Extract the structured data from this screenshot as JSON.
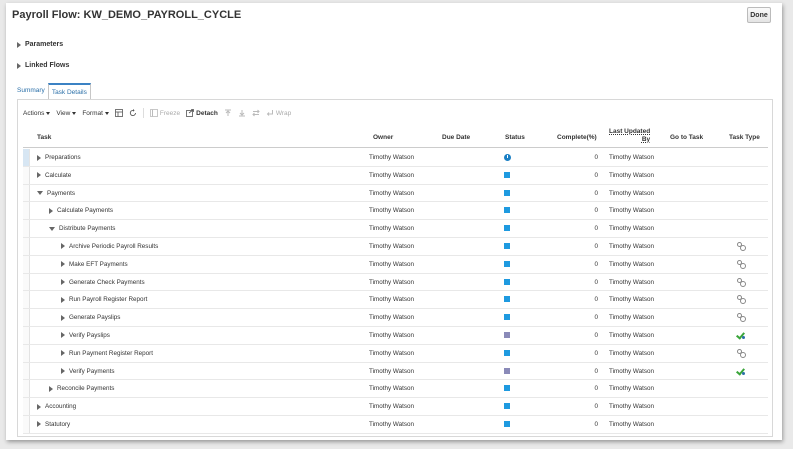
{
  "header": {
    "title": "Payroll Flow: KW_DEMO_PAYROLL_CYCLE",
    "done_label": "Done"
  },
  "sections": {
    "parameters": "Parameters",
    "linked_flows": "Linked Flows"
  },
  "tabs": [
    {
      "label": "Summary"
    },
    {
      "label": "Task Details"
    }
  ],
  "toolbar": {
    "actions": "Actions",
    "view": "View",
    "format": "Format",
    "freeze": "Freeze",
    "detach": "Detach",
    "wrap": "Wrap"
  },
  "columns": {
    "task": "Task",
    "owner": "Owner",
    "due_date": "Due Date",
    "status": "Status",
    "complete": "Complete(%)",
    "last_updated_1": "Last Updated",
    "last_updated_2": "By",
    "go_to_task": "Go to Task",
    "task_type": "Task Type"
  },
  "colors": {
    "status_blue": "#1e9ae0",
    "status_grey": "#8a8ab8",
    "accent": "#2a6fa8"
  },
  "rows": [
    {
      "task": "Preparations",
      "level": 0,
      "expand": "collapsed",
      "owner": "Timothy Watson",
      "status": "clock-icon",
      "complete": "0",
      "updated_by": "Timothy Watson",
      "task_type": ""
    },
    {
      "task": "Calculate",
      "level": 0,
      "expand": "collapsed",
      "owner": "Timothy Watson",
      "status": "blue-square",
      "complete": "0",
      "updated_by": "Timothy Watson",
      "task_type": ""
    },
    {
      "task": "Payments",
      "level": 0,
      "expand": "expanded",
      "owner": "Timothy Watson",
      "status": "blue-square",
      "complete": "0",
      "updated_by": "Timothy Watson",
      "task_type": ""
    },
    {
      "task": "Calculate Payments",
      "level": 1,
      "expand": "collapsed",
      "owner": "Timothy Watson",
      "status": "blue-square",
      "complete": "0",
      "updated_by": "Timothy Watson",
      "task_type": ""
    },
    {
      "task": "Distribute Payments",
      "level": 1,
      "expand": "expanded",
      "owner": "Timothy Watson",
      "status": "blue-square",
      "complete": "0",
      "updated_by": "Timothy Watson",
      "task_type": ""
    },
    {
      "task": "Archive Periodic Payroll Results",
      "level": 2,
      "expand": "collapsed",
      "owner": "Timothy Watson",
      "status": "blue-square",
      "complete": "0",
      "updated_by": "Timothy Watson",
      "task_type": "gear-icon"
    },
    {
      "task": "Make EFT Payments",
      "level": 2,
      "expand": "collapsed",
      "owner": "Timothy Watson",
      "status": "blue-square",
      "complete": "0",
      "updated_by": "Timothy Watson",
      "task_type": "gear-icon"
    },
    {
      "task": "Generate Check Payments",
      "level": 2,
      "expand": "collapsed",
      "owner": "Timothy Watson",
      "status": "blue-square",
      "complete": "0",
      "updated_by": "Timothy Watson",
      "task_type": "gear-icon"
    },
    {
      "task": "Run Payroll Register Report",
      "level": 2,
      "expand": "collapsed",
      "owner": "Timothy Watson",
      "status": "blue-square",
      "complete": "0",
      "updated_by": "Timothy Watson",
      "task_type": "gear-icon"
    },
    {
      "task": "Generate Payslips",
      "level": 2,
      "expand": "collapsed",
      "owner": "Timothy Watson",
      "status": "blue-square",
      "complete": "0",
      "updated_by": "Timothy Watson",
      "task_type": "gear-icon"
    },
    {
      "task": "Verify Payslips",
      "level": 2,
      "expand": "collapsed",
      "owner": "Timothy Watson",
      "status": "grey-square",
      "complete": "0",
      "updated_by": "Timothy Watson",
      "task_type": "check-icon"
    },
    {
      "task": "Run Payment Register Report",
      "level": 2,
      "expand": "collapsed",
      "owner": "Timothy Watson",
      "status": "blue-square",
      "complete": "0",
      "updated_by": "Timothy Watson",
      "task_type": "gear-icon"
    },
    {
      "task": "Verify Payments",
      "level": 2,
      "expand": "collapsed",
      "owner": "Timothy Watson",
      "status": "grey-square",
      "complete": "0",
      "updated_by": "Timothy Watson",
      "task_type": "check-icon"
    },
    {
      "task": "Reconcile Payments",
      "level": 1,
      "expand": "collapsed",
      "owner": "Timothy Watson",
      "status": "blue-square",
      "complete": "0",
      "updated_by": "Timothy Watson",
      "task_type": ""
    },
    {
      "task": "Accounting",
      "level": 0,
      "expand": "collapsed",
      "owner": "Timothy Watson",
      "status": "blue-square",
      "complete": "0",
      "updated_by": "Timothy Watson",
      "task_type": ""
    },
    {
      "task": "Statutory",
      "level": 0,
      "expand": "collapsed",
      "owner": "Timothy Watson",
      "status": "blue-square",
      "complete": "0",
      "updated_by": "Timothy Watson",
      "task_type": ""
    }
  ]
}
